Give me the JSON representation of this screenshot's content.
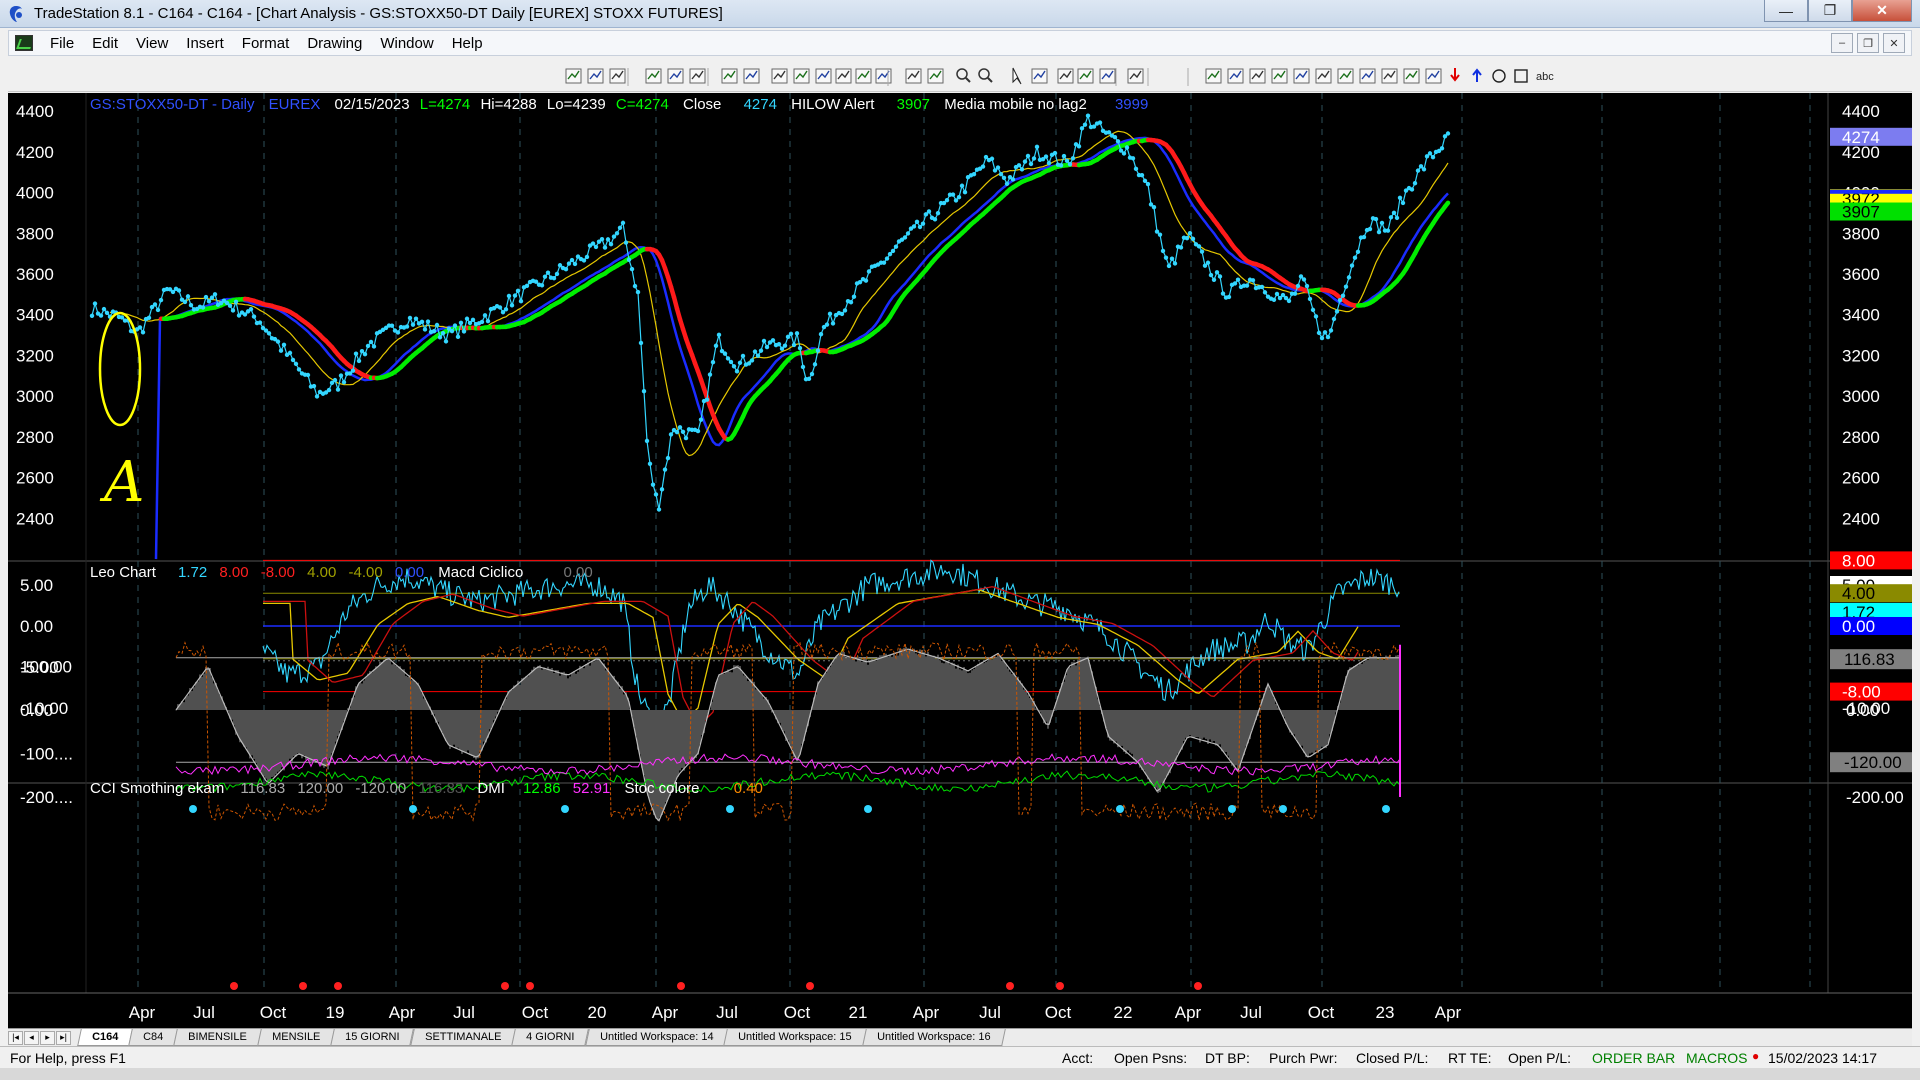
{
  "window": {
    "title": "TradeStation 8.1 - C164 - C164 - [Chart Analysis - GS:STOXX50-DT  Daily  [EUREX] STOXX FUTURES]",
    "buttons": {
      "minimize": "—",
      "restore": "❐",
      "close": "✕"
    }
  },
  "menu": {
    "items": [
      "File",
      "Edit",
      "View",
      "Insert",
      "Format",
      "Drawing",
      "Window",
      "Help"
    ]
  },
  "chart": {
    "price_header": {
      "symbol": "GS:STOXX50-DT - Daily",
      "exchange": "EUREX",
      "date": "02/15/2023",
      "last": "L=4274",
      "high": "Hi=4288",
      "low": "Lo=4239",
      "close_value": "C=4274",
      "close_label": "Close",
      "close_plot": "4274",
      "hilow_label": "HILOW Alert",
      "hilow_value": "3907",
      "ma_label": "Media mobile no lag2",
      "ma_value": "3999"
    },
    "price_axis": {
      "ticks": [
        "4400",
        "4200",
        "4000",
        "3800",
        "3600",
        "3400",
        "3200",
        "3000",
        "2800",
        "2600",
        "2400"
      ],
      "badges": [
        {
          "text": "4274",
          "color": "#7c7cf0"
        },
        {
          "text": "3972",
          "color": "#ffff00"
        },
        {
          "text": "3907",
          "color": "#00e000"
        }
      ]
    },
    "annotation": {
      "letter": "A",
      "color": "#ffff00"
    },
    "leo_header": {
      "name": "Leo Chart",
      "v1": "1.72",
      "v2": "8.00",
      "v3": "-8.00",
      "v4": "4.00",
      "v5": "-4.00",
      "v6": "0.00",
      "macd_label": "Macd Ciclico",
      "macd_value": "0.00"
    },
    "leo_axis": {
      "ticks": [
        "5.00",
        "0.00",
        "-5.00",
        "-10.00"
      ],
      "badges": [
        {
          "text": "8.00",
          "color": "#ff0000"
        },
        {
          "text": "5.00",
          "color": "#ffffff"
        },
        {
          "text": "4.00",
          "color": "#8a8a00"
        },
        {
          "text": "1.72",
          "color": "#00ffff"
        },
        {
          "text": "0.00",
          "color": "#0000ff"
        },
        {
          "text": "-4.00",
          "color": "#6b6b00"
        },
        {
          "text": "-8.00",
          "color": "#ff0000"
        }
      ],
      "right_ticks": [
        "-10.00"
      ]
    },
    "cci_header": {
      "name": "CCI Smothing ekam",
      "v1": "116.83",
      "v2": "120.00",
      "v3": "-120.00",
      "v4": "116.83",
      "dmi_label": "DMI",
      "dmi_plus": "12.86",
      "dmi_minus": "52.91",
      "stoc_label": "Stoc colore",
      "stoc_value": "0.40"
    },
    "cci_axis": {
      "ticks": [
        "100.00",
        "0.00",
        "-100....",
        "-200...."
      ],
      "right_ticks": [
        "0.00",
        "-200.00"
      ],
      "badges": [
        {
          "text": "116.83",
          "color": "#808080"
        },
        {
          "text": "-120.00",
          "color": "#808080"
        }
      ]
    },
    "time_axis": [
      "Apr",
      "Jul",
      "Oct",
      "19",
      "Apr",
      "Jul",
      "Oct",
      "20",
      "Apr",
      "Jul",
      "Oct",
      "21",
      "Apr",
      "Jul",
      "Oct",
      "22",
      "Apr",
      "Jul",
      "Oct",
      "23",
      "Apr"
    ]
  },
  "tabs": {
    "items": [
      "C164",
      "C84",
      "BIMENSILE",
      "MENSILE",
      "15 GIORNI",
      "SETTIMANALE",
      "4 GIORNI",
      "Untitled Workspace:  14",
      "Untitled Workspace:  15",
      "Untitled Workspace:  16"
    ],
    "active": 0
  },
  "status": {
    "help": "For Help, press F1",
    "acct": "Acct:",
    "open_psns": "Open Psns:",
    "dt_bp": "DT BP:",
    "purch_pwr": "Purch Pwr:",
    "closed_pl": "Closed P/L:",
    "rt_te": "RT TE:",
    "open_pl": "Open P/L:",
    "order_bar": "ORDER BAR",
    "macros": "MACROS",
    "datetime": "15/02/2023 14:17",
    "accent": "#008000"
  },
  "colors": {
    "price_dots": "#33d6ff",
    "trend_up": "#00ee00",
    "trend_down": "#ff1a1a",
    "ma_blue": "#1a2cff",
    "ma_yellow": "#e6c800",
    "header_blue": "#3050ff"
  }
}
